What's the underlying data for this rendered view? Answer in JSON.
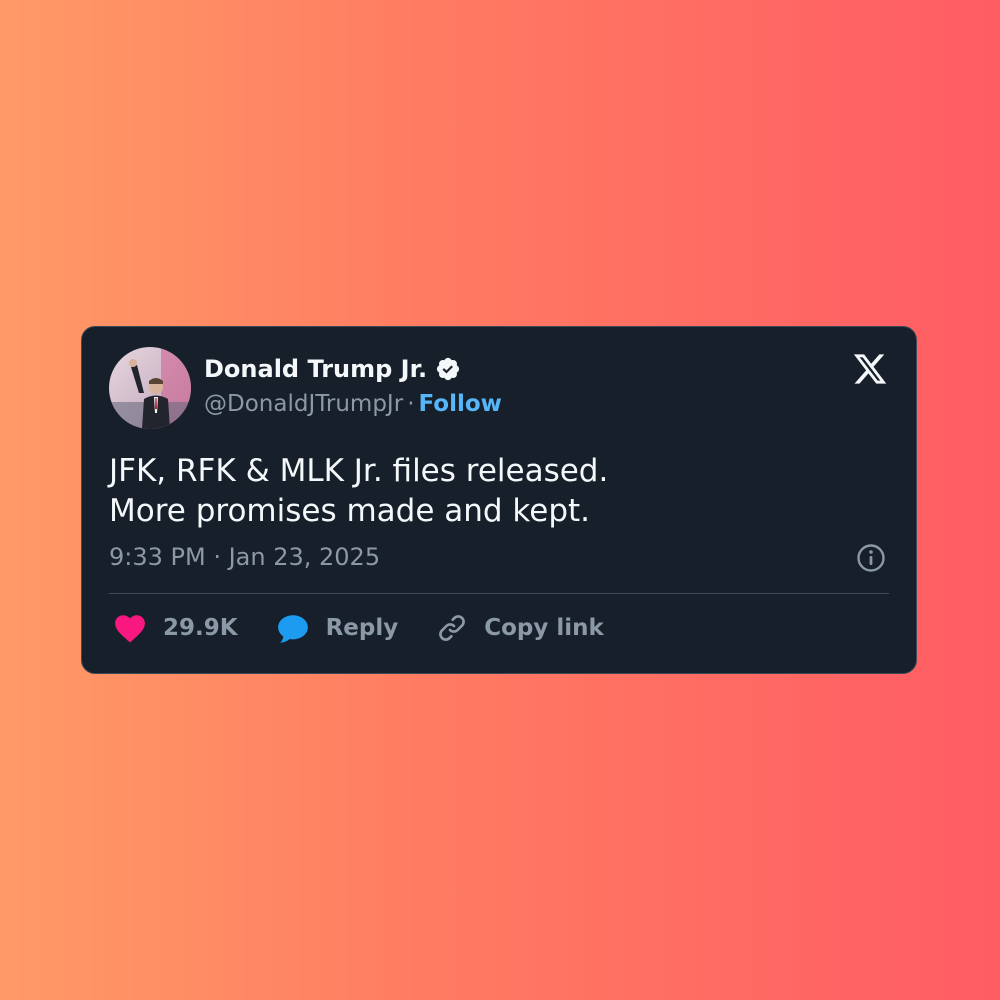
{
  "author": {
    "name": "Donald Trump Jr.",
    "handle": "@DonaldJTrumpJr",
    "separator": "·",
    "follow_label": "Follow",
    "verified_icon": "verified-badge-icon",
    "avatar": "profile-photo"
  },
  "brand": {
    "logo_icon": "x-logo-icon"
  },
  "tweet": {
    "lines": [
      "JFK, RFK & MLK Jr. files released.",
      "More promises made and kept."
    ],
    "timestamp": "9:33 PM · Jan 23, 2025",
    "info_icon": "info-icon"
  },
  "actions": {
    "likes": {
      "icon": "heart-icon",
      "label": "29.9K",
      "color": "#f91880"
    },
    "reply": {
      "icon": "reply-bubble-icon",
      "label": "Reply",
      "color": "#1d9bf0"
    },
    "copy_link": {
      "icon": "link-icon",
      "label": "Copy link",
      "color": "#8b98a5"
    }
  },
  "colors": {
    "card_background": "#161f2a",
    "text_primary": "#f5f8fa",
    "text_secondary": "#8b98a5",
    "accent": "#1d9bf0",
    "background_gradient": [
      "#ff9a66",
      "#ff5c64"
    ]
  }
}
